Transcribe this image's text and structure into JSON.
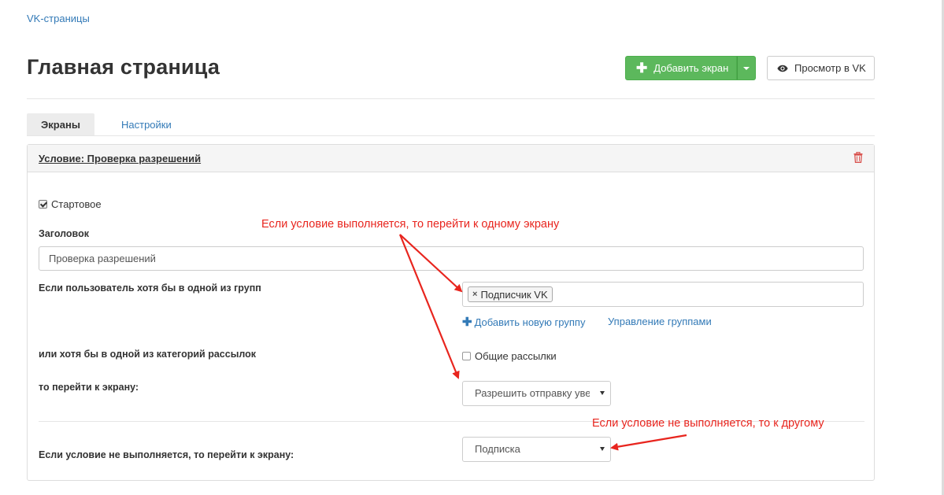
{
  "breadcrumb": "VK-страницы",
  "page_title": "Главная страница",
  "toolbar": {
    "add_screen_label": "Добавить экран",
    "view_in_vk_label": "Просмотр в VK"
  },
  "tabs": [
    {
      "label": "Экраны",
      "active": true
    },
    {
      "label": "Настройки",
      "active": false
    }
  ],
  "panel": {
    "title": "Условие: Проверка разрешений",
    "start_checkbox_label": "Стартовое",
    "start_checked": true,
    "heading_label": "Заголовок",
    "heading_value": "Проверка разрешений",
    "groups_label": "Если пользователь хотя бы в одной из групп",
    "group_tags": [
      "Подписчик VK"
    ],
    "add_group_link": "Добавить новую группу",
    "manage_groups_link": "Управление группами",
    "categories_label": "или хотя бы в одной из категорий рассылок",
    "category_checkbox_label": "Общие рассылки",
    "category_checked": false,
    "goto_label": "то перейти к экрану:",
    "goto_value": "Разрешить отправку уведомлений",
    "else_label": "Если условие не выполняется, то перейти к экрану:",
    "else_value": "Подписка"
  },
  "annotations": {
    "top": "Если условие выполняется, то перейти к одному экрану",
    "bottom": "Если условие не выполняется, то к другому"
  },
  "colors": {
    "primary_link": "#337ab7",
    "success_button": "#5cb85c",
    "annotation_red": "#e8251e",
    "delete_icon": "#d9534f"
  }
}
